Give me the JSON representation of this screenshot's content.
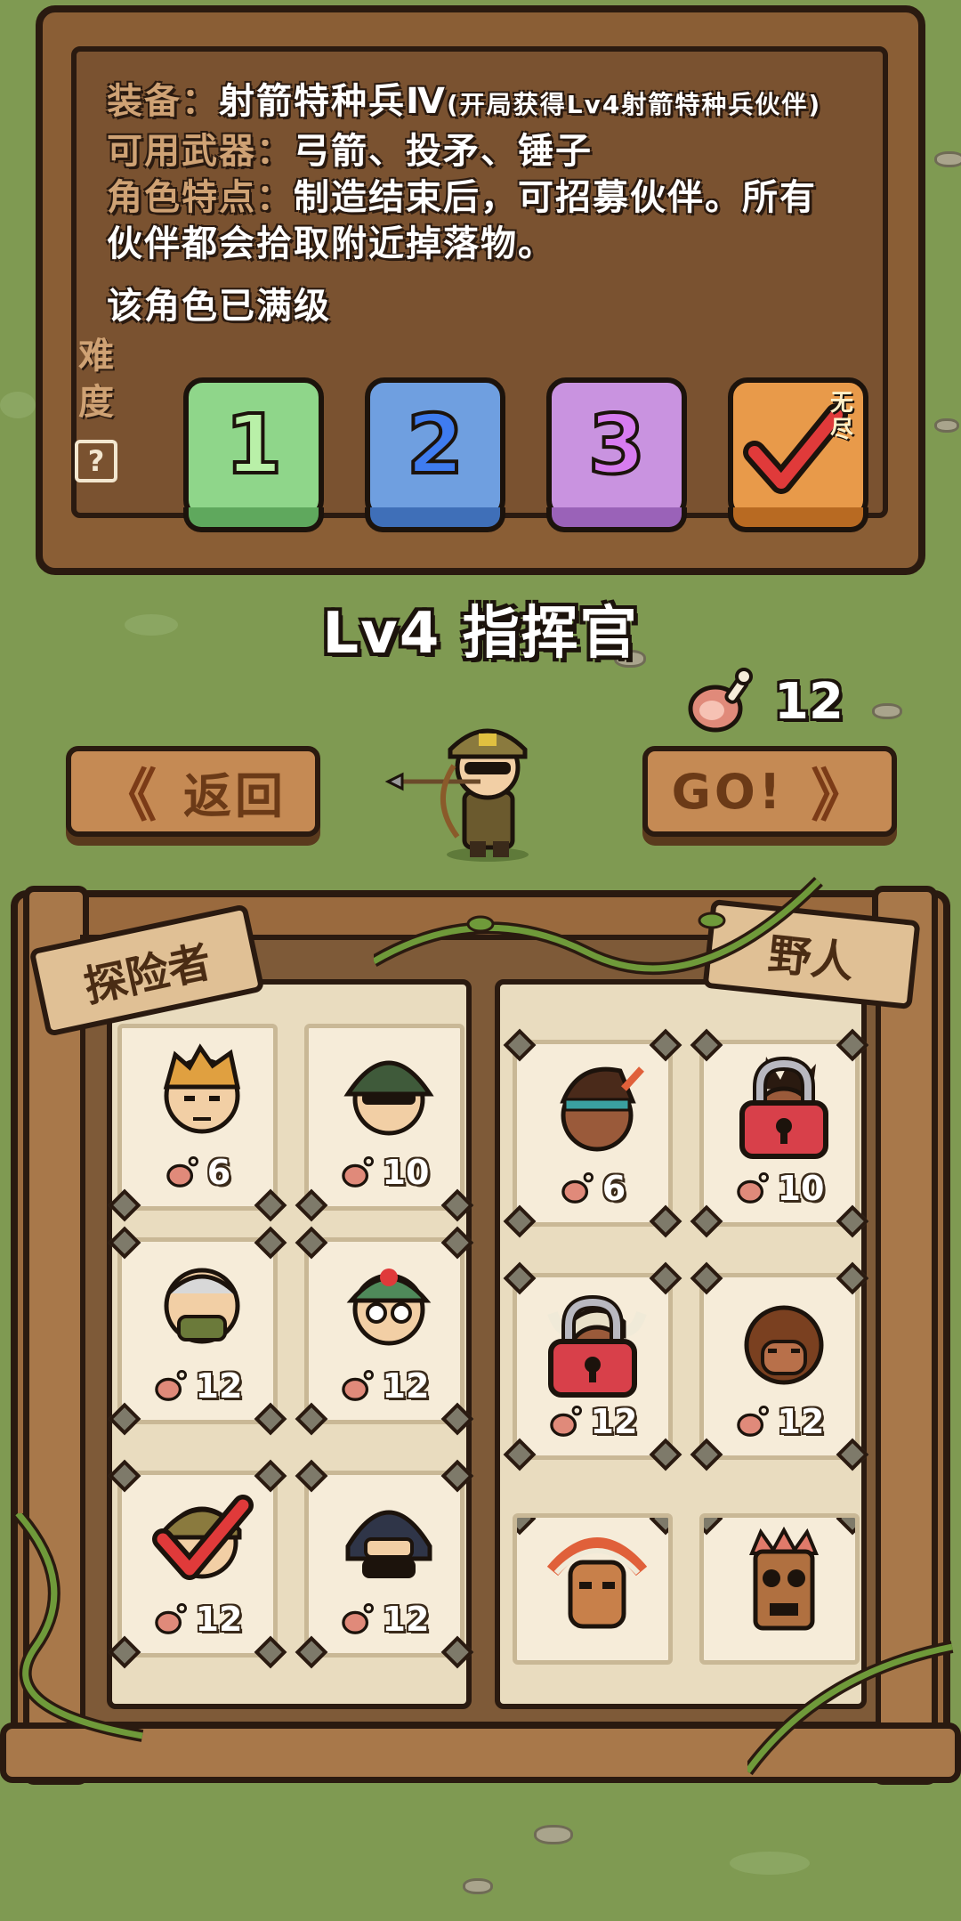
{
  "info": {
    "equip_key": "装备：",
    "equip_value": "射箭特种兵Ⅳ",
    "equip_note": "(开局获得Lv4射箭特种兵伙伴)",
    "weapons_key": "可用武器：",
    "weapons_value": "弓箭、投矛、锤子",
    "trait_key": "角色特点：",
    "trait_value_1": "制造结束后，可招募伙伴。所有",
    "trait_value_2": "伙伴都会拾取附近掉落物。",
    "maxed": "该角色已满级"
  },
  "difficulty": {
    "label_1": "难",
    "label_2": "度",
    "help": "?",
    "buttons": [
      {
        "label": "1",
        "color": "#8fd68a"
      },
      {
        "label": "2",
        "color": "#6f9fe0"
      },
      {
        "label": "3",
        "color": "#c993e0"
      }
    ],
    "endless_label": "无尽",
    "endless_color": "#e89a4a",
    "selected": "endless"
  },
  "hero": {
    "title": "Lv4 指挥官",
    "meat": "12"
  },
  "buttons": {
    "back": "返回",
    "go": "GO!"
  },
  "tabs": {
    "explorers": "探险者",
    "savages": "野人"
  },
  "explorers": [
    {
      "name": "blond-soldier",
      "cost": "6",
      "locked": false,
      "selected": false
    },
    {
      "name": "helmet-soldier",
      "cost": "10",
      "locked": false,
      "selected": false
    },
    {
      "name": "masked-veteran",
      "cost": "12",
      "locked": false,
      "selected": false
    },
    {
      "name": "medic",
      "cost": "12",
      "locked": false,
      "selected": false
    },
    {
      "name": "commander",
      "cost": "12",
      "locked": false,
      "selected": true
    },
    {
      "name": "swat",
      "cost": "12",
      "locked": false,
      "selected": false
    }
  ],
  "savages": [
    {
      "name": "tribal-warrior",
      "cost": "6",
      "locked": false
    },
    {
      "name": "feather-chief",
      "cost": "10",
      "locked": true
    },
    {
      "name": "horned-shaman",
      "cost": "12",
      "locked": true
    },
    {
      "name": "caveman",
      "cost": "12",
      "locked": false
    },
    {
      "name": "tiki-chief",
      "cost": "",
      "locked": false
    },
    {
      "name": "tiki-mask",
      "cost": "",
      "locked": false
    }
  ]
}
